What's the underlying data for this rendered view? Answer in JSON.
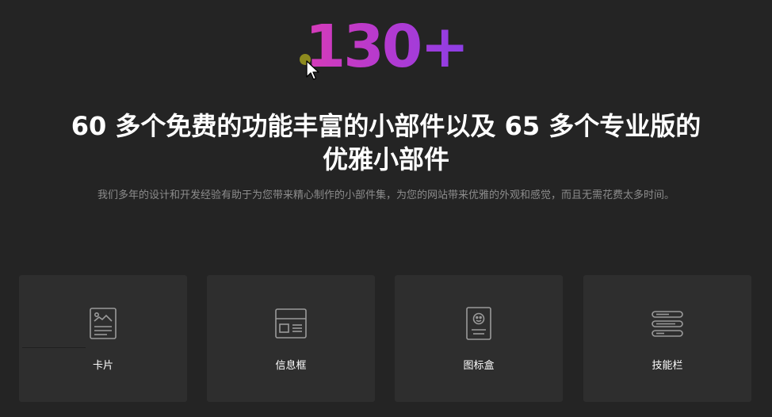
{
  "hero": {
    "counter": "130+",
    "headline": "60 多个免费的功能丰富的小部件以及 65 多个专业版的优雅小部件",
    "description": "我们多年的设计和开发经验有助于为您带来精心制作的小部件集，为您的网站带来优雅的外观和感觉，而且无需花费太多时间。"
  },
  "cards": [
    {
      "label": "卡片",
      "icon": "card-icon"
    },
    {
      "label": "信息框",
      "icon": "info-box-icon"
    },
    {
      "label": "图标盒",
      "icon": "icon-box-icon"
    },
    {
      "label": "技能栏",
      "icon": "skill-bar-icon"
    }
  ],
  "colors": {
    "background": "#242424",
    "card": "#2e2e2e",
    "gradient_start": "#d63bb8",
    "gradient_end": "#8b3ee6",
    "text": "#ffffff",
    "muted_text": "#8c8c8c"
  }
}
